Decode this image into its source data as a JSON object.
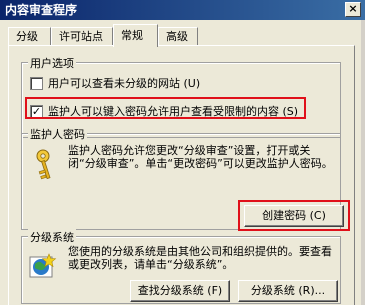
{
  "window": {
    "title": "内容审查程序",
    "close_glyph": "×"
  },
  "tabs": [
    {
      "label": "分级"
    },
    {
      "label": "许可站点"
    },
    {
      "label": "常规"
    },
    {
      "label": "高级"
    }
  ],
  "active_tab": "常规",
  "user_options": {
    "title": "用户选项",
    "opt1": {
      "label": "用户可以查看未分级的网站 (U)",
      "checked": false
    },
    "opt2": {
      "label": "监护人可以键入密码允许用户查看受限制的内容 (S)",
      "checked": true,
      "check_glyph": "✓"
    }
  },
  "supervisor": {
    "title": "监护人密码",
    "icon": "key-icon",
    "description": "监护人密码允许您更改“分级审查”设置，打开或关闭“分级审查”。单击“更改密码”可以更改监护人密码。",
    "create_button": "创建密码 (C)"
  },
  "rating_systems": {
    "title": "分级系统",
    "icon": "rating-system-icon",
    "description": "您使用的分级系统是由其他公司和组织提供的。要查看或更改列表，请单击“分级系统”。",
    "find_button": "查找分级系统 (F)",
    "systems_button": "分级系统 (R)..."
  },
  "colors": {
    "title_bar": "#0a246a",
    "highlight": "#e0101a"
  }
}
